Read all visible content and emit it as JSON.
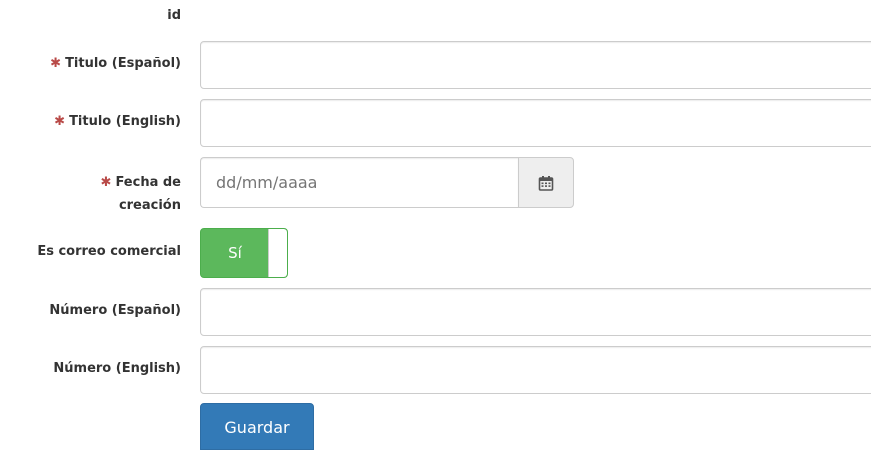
{
  "form": {
    "id_label": "id",
    "required_mark": "✱",
    "titulo_es": {
      "label": "Titulo (Español)",
      "value": ""
    },
    "titulo_en": {
      "label": "Titulo (English)",
      "value": ""
    },
    "fecha": {
      "label_line1": "Fecha de",
      "label_line2": "creación",
      "placeholder": "dd/mm/aaaa",
      "value": ""
    },
    "comercial": {
      "label": "Es correo comercial",
      "toggle_text": "Sí",
      "state": true
    },
    "numero_es": {
      "label": "Número (Español)",
      "value": ""
    },
    "numero_en": {
      "label": "Número (English)",
      "value": ""
    },
    "submit_label": "Guardar"
  },
  "icons": {
    "calendar": "calendar-icon"
  },
  "colors": {
    "required": "#b94a48",
    "toggle_on": "#5cb85c",
    "primary_button": "#337ab7"
  }
}
